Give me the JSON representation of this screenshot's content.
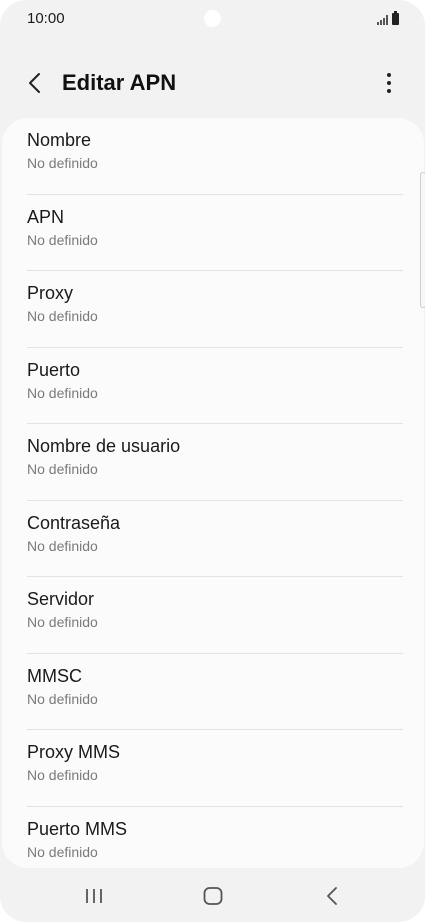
{
  "status_bar": {
    "time": "10:00",
    "icons": [
      "signal-icon",
      "battery-icon"
    ]
  },
  "header": {
    "title": "Editar APN",
    "back_icon": "chevron-left-icon",
    "more_icon": "more-vertical-icon"
  },
  "apn_fields": [
    {
      "label": "Nombre",
      "value": "No definido"
    },
    {
      "label": "APN",
      "value": "No definido"
    },
    {
      "label": "Proxy",
      "value": "No definido"
    },
    {
      "label": "Puerto",
      "value": "No definido"
    },
    {
      "label": "Nombre de usuario",
      "value": "No definido"
    },
    {
      "label": "Contraseña",
      "value": "No definido"
    },
    {
      "label": "Servidor",
      "value": "No definido"
    },
    {
      "label": "MMSC",
      "value": "No definido"
    },
    {
      "label": "Proxy MMS",
      "value": "No definido"
    },
    {
      "label": "Puerto MMS",
      "value": "No definido"
    }
  ],
  "nav_bar": {
    "buttons": [
      "recent-apps-icon",
      "home-icon",
      "back-icon"
    ]
  },
  "colors": {
    "background": "#f2f2f2",
    "card": "#fbfbfb",
    "title_text": "#111111",
    "secondary_text": "#7a7a7a"
  }
}
